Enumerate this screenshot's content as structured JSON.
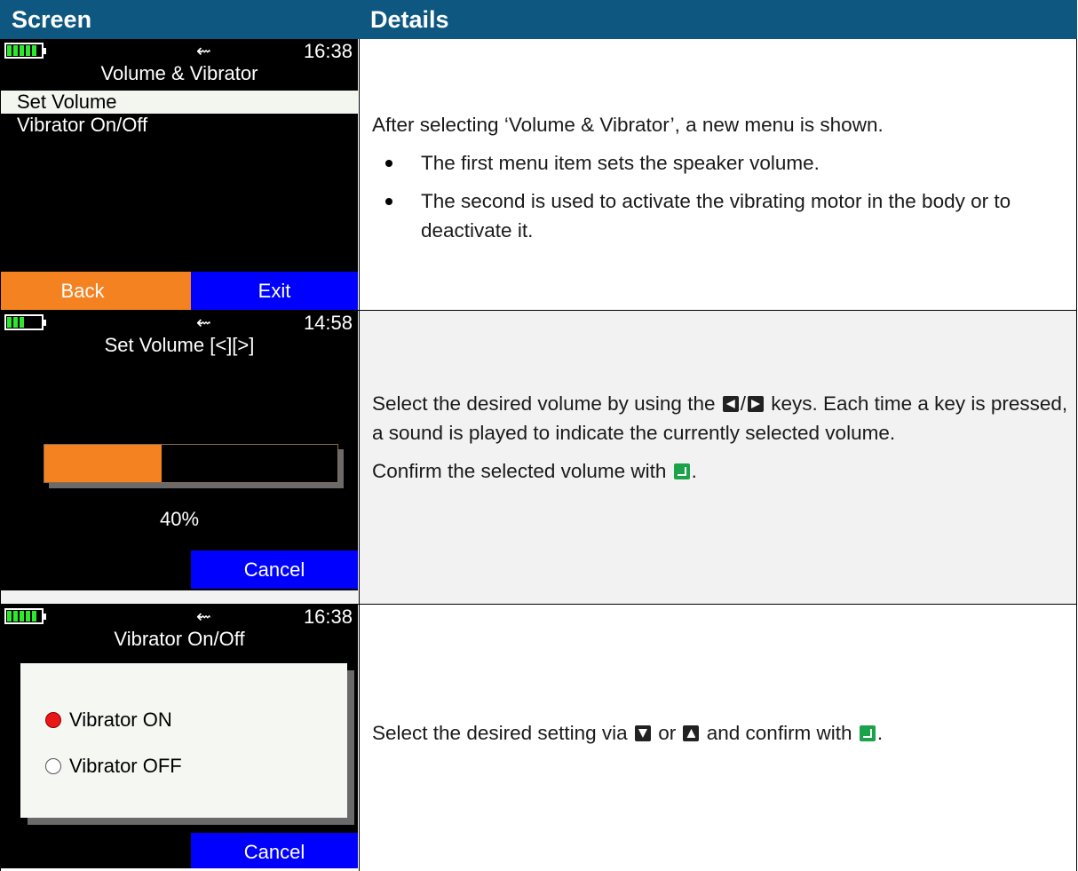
{
  "header": {
    "col1": "Screen",
    "col2": "Details"
  },
  "rows": [
    {
      "screen": {
        "clock": "16:38",
        "usb_icon": "⇜",
        "title": "Volume & Vibrator",
        "menu": [
          "Set Volume",
          "Vibrator On/Off"
        ],
        "left_softkey": "Back",
        "right_softkey": "Exit",
        "battery_bars": 5
      },
      "details": {
        "intro": "After selecting ‘Volume & Vibrator’, a new menu is shown.",
        "bullets": [
          "The first menu item sets the speaker volume.",
          "The second is used to activate the vibrating motor in the body or to deactivate it."
        ]
      }
    },
    {
      "screen": {
        "clock": "14:58",
        "usb_icon": "⇜",
        "title": "Set Volume [<][>]",
        "volume_fraction": 0.4,
        "volume_label": "40%",
        "right_softkey": "Cancel",
        "battery_bars": 3
      },
      "details": {
        "line1_a": "Select the desired volume by using the",
        "line1_sep": "/",
        "line1_b": "keys. Each time a key is pressed, a sound is played to indicate the currently selected volume.",
        "line2_a": "Confirm the selected volume with",
        "line2_b": "."
      }
    },
    {
      "screen": {
        "clock": "16:38",
        "usb_icon": "⇜",
        "title": "Vibrator On/Off",
        "option_on": "Vibrator ON",
        "option_off": "Vibrator OFF",
        "right_softkey": "Cancel",
        "battery_bars": 5
      },
      "details": {
        "text_a": "Select the desired setting via",
        "text_or": "or",
        "text_b": "and confirm with",
        "text_end": "."
      }
    }
  ],
  "colors": {
    "header_bg": "#0d5781",
    "softkey_orange": "#f58220",
    "softkey_blue": "#0000ff",
    "battery_green": "#2ee82e",
    "enter_key_green": "#1aa34a"
  }
}
